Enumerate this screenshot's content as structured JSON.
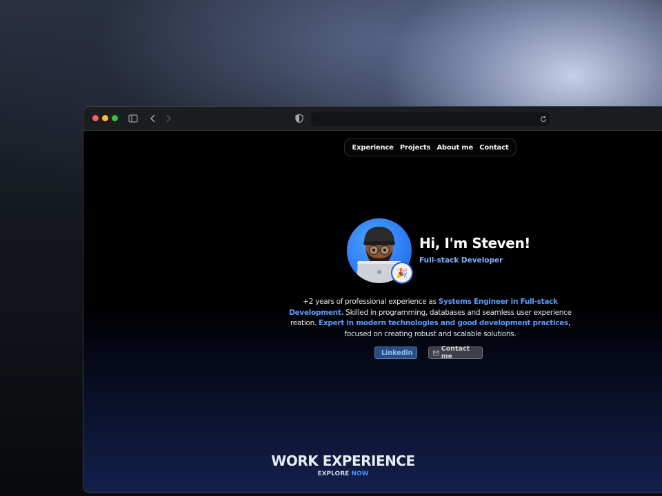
{
  "nav": {
    "items": [
      {
        "label": "Experience"
      },
      {
        "label": "Projects"
      },
      {
        "label": "About me"
      },
      {
        "label": "Contact"
      }
    ]
  },
  "hero": {
    "greeting": "Hi, I'm Steven!",
    "role": "Full-stack Developer",
    "bio": {
      "p1": "+2 years of professional experience as ",
      "h1": "Systems Engineer in Full-stack Development.",
      "p2": " Skilled in programming, databases and seamless user experience reation. ",
      "h2": "Expert in modern technologies and good development practices",
      "p3": ", focused on creating robust and scalable solutions."
    },
    "buttons": {
      "linkedin": "Linkedin",
      "contact": "Contact me"
    }
  },
  "work": {
    "title": "WORK EXPERIENCE",
    "explore_a": "EXPLORE ",
    "explore_b": "NOW"
  },
  "colors": {
    "accent": "#5e9bff",
    "traffic_red": "#ff5f57",
    "traffic_yellow": "#febc2e",
    "traffic_green": "#28c840"
  },
  "icons": [
    "sidebar-icon",
    "back-chevron-icon",
    "forward-chevron-icon",
    "shield-icon",
    "reload-icon",
    "linkedin-icon",
    "mail-icon",
    "party-popper-icon"
  ]
}
